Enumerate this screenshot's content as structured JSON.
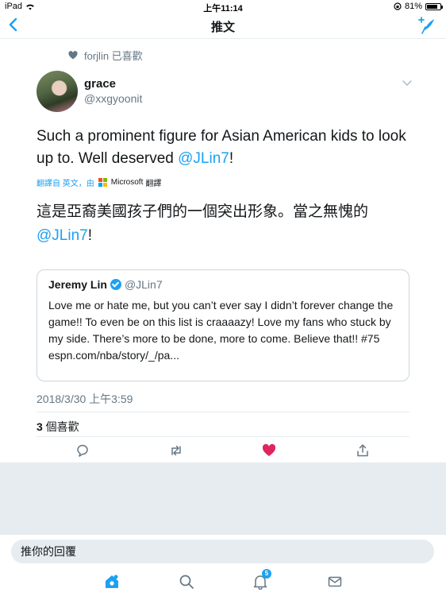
{
  "status_bar": {
    "device": "iPad",
    "time": "上午11:14",
    "battery": "81%",
    "battery_level": 0.81
  },
  "nav": {
    "title": "推文"
  },
  "social_context": {
    "text": "forjlin 已喜歡"
  },
  "tweet": {
    "author_name": "grace",
    "author_handle": "@xxgyoonit",
    "text_before": "Such a prominent figure for Asian American kids to look up to. Well deserved ",
    "mention": "@JLin7",
    "text_after": "!",
    "translate_label": "翻譯自 英文，由",
    "translate_provider": "Microsoft",
    "translate_suffix": "翻譯",
    "translated_text": "這是亞裔美國孩子們的一個突出形象。當之無愧的",
    "translated_mention": "@JLin7",
    "translated_after": "!",
    "timestamp": "2018/3/30 上午3:59",
    "likes_count": "3",
    "likes_label": " 個喜歡"
  },
  "quote": {
    "author_name": "Jeremy Lin",
    "author_handle": "@JLin7",
    "text": "Love me or hate me, but you can’t ever say I didn’t forever change the game!! To even be on this list is craaaazy! Love my fans who stuck by my side. There’s more to be done, more to come. Believe that!! #75",
    "link": "espn.com/nba/story/_/pa..."
  },
  "reply": {
    "placeholder": "推你的回覆"
  },
  "tabs": {
    "notifications_badge": "5"
  },
  "colors": {
    "accent": "#1da1f2",
    "like_active": "#e0245e",
    "secondary_text": "#657786"
  }
}
